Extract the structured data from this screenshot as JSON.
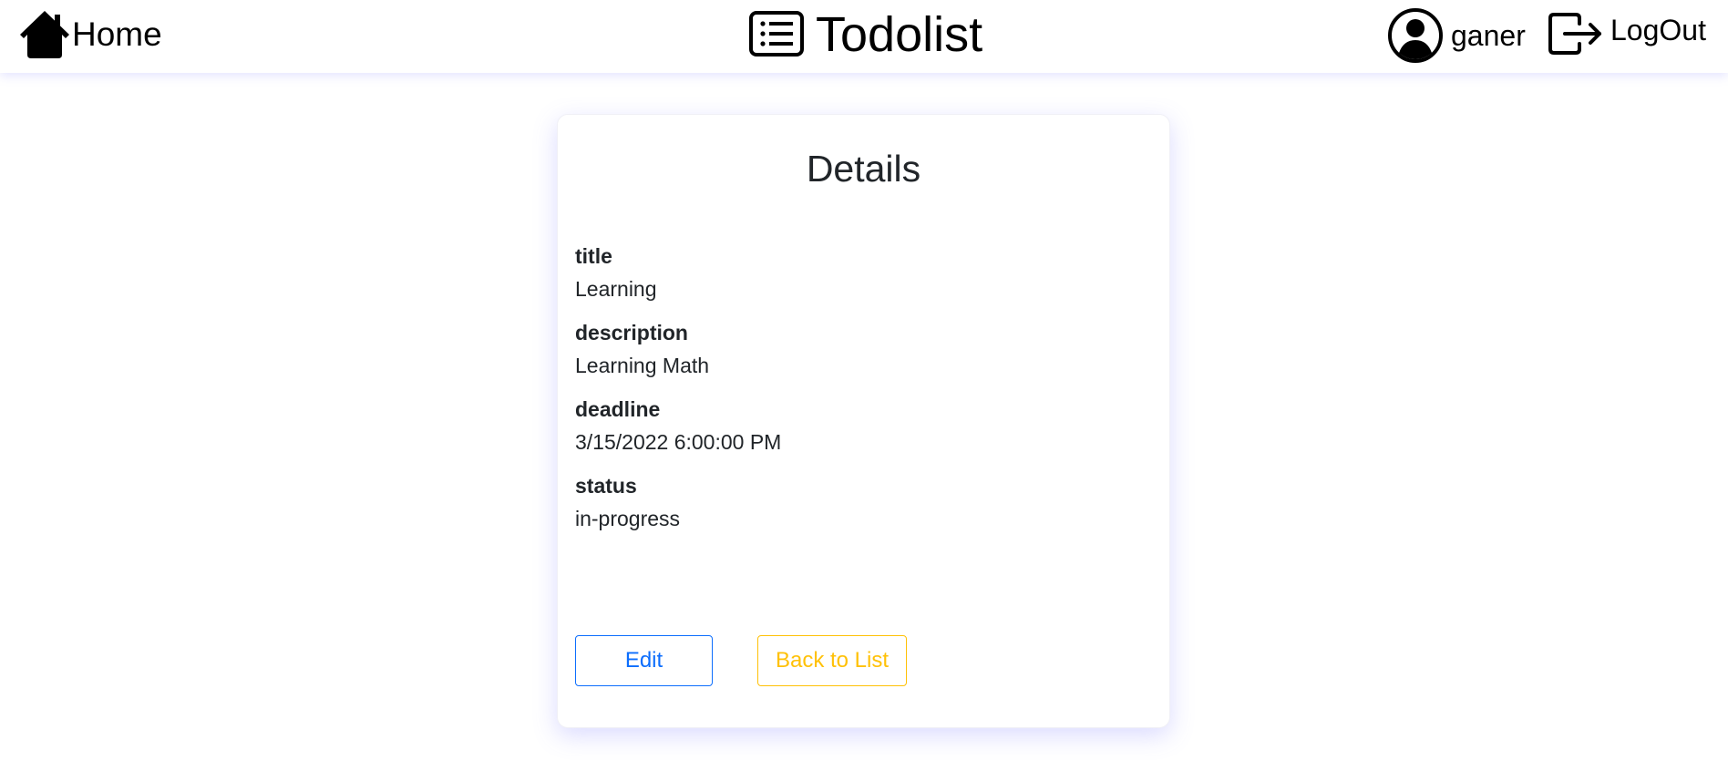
{
  "navbar": {
    "home_label": "Home",
    "brand_label": "Todolist",
    "user_label": "ganer",
    "logout_label": "LogOut"
  },
  "card": {
    "title": "Details",
    "fields": [
      {
        "label": "title",
        "value": "Learning"
      },
      {
        "label": "description",
        "value": "Learning Math"
      },
      {
        "label": "deadline",
        "value": "3/15/2022 6:00:00 PM"
      },
      {
        "label": "status",
        "value": "in-progress"
      }
    ],
    "edit_label": "Edit",
    "back_label": "Back to List"
  },
  "icons": {
    "home": "house-icon",
    "brand": "list-icon",
    "user": "user-circle-icon",
    "logout": "logout-icon"
  },
  "colors": {
    "primary": "#0d6efd",
    "warning": "#ffc107",
    "text": "#212529"
  }
}
